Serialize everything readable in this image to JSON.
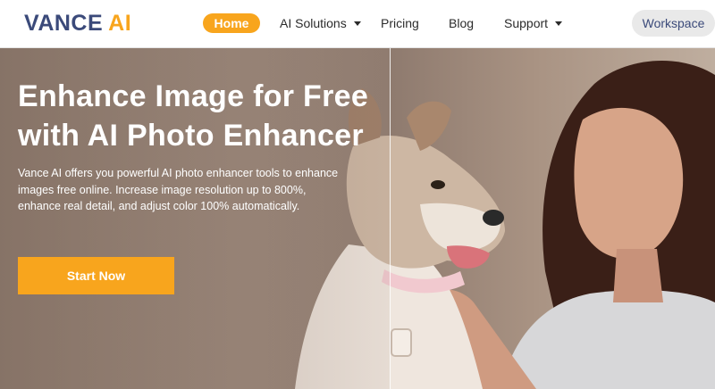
{
  "logo": {
    "part1": "VANCE",
    "part2": "AI"
  },
  "nav": {
    "home": "Home",
    "ai_solutions": "AI Solutions",
    "pricing": "Pricing",
    "blog": "Blog",
    "support": "Support",
    "workspace": "Workspace"
  },
  "hero": {
    "title_line1": "Enhance Image for Free",
    "title_line2": "with AI Photo Enhancer",
    "description": "Vance AI offers you powerful AI photo enhancer tools to enhance images free online. Increase image resolution up to 800%, enhance real detail, and adjust color 100% automatically.",
    "cta_label": "Start Now"
  },
  "colors": {
    "accent": "#f8a51d",
    "brand_dark": "#3b4a7a"
  },
  "icons": [
    "ai-solutions-caret-icon",
    "support-caret-icon"
  ]
}
